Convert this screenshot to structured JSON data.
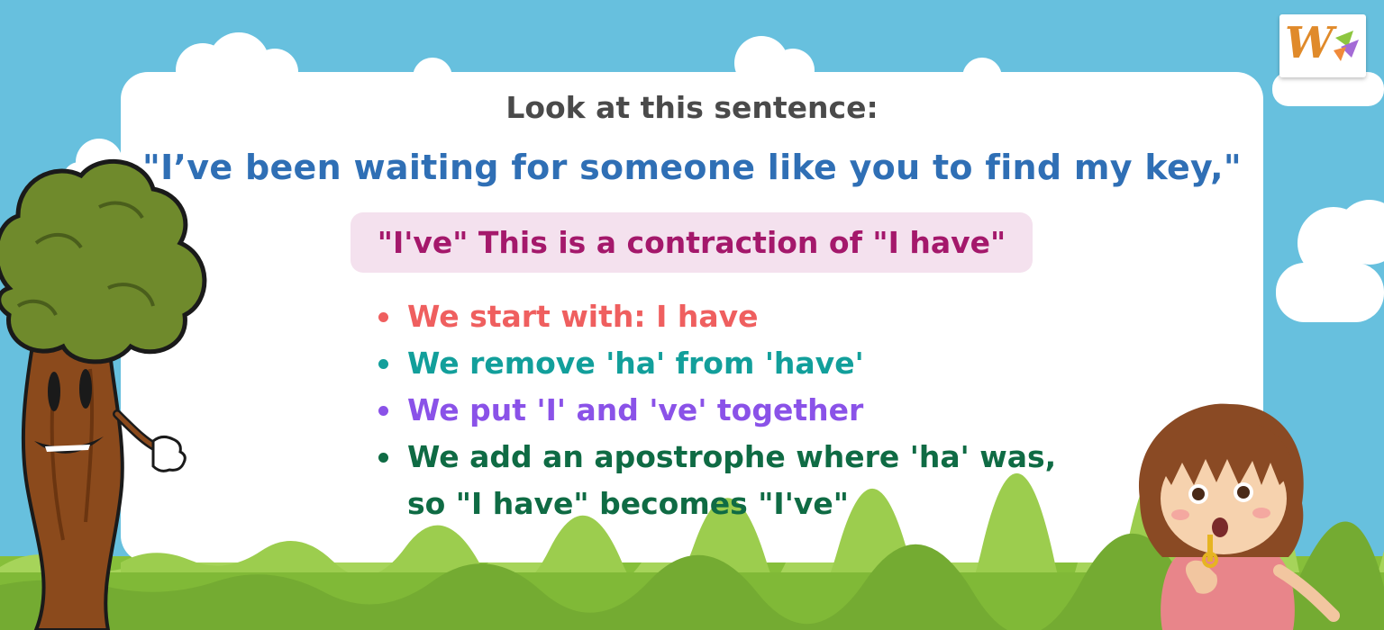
{
  "lesson": {
    "heading": "Look at this sentence:",
    "sentence": "\"I’ve been waiting for someone like you to find my key,\"",
    "explanation": "\"I've\" This is a contraction of \"I have\"",
    "steps": [
      {
        "text": "We start with: I have",
        "color": "#ef5f5f"
      },
      {
        "text": "We remove 'ha' from 'have'",
        "color": "#129f9b"
      },
      {
        "text": "We put 'I' and 've' together",
        "color": "#8a52e8"
      },
      {
        "text": "We add an apostrophe where 'ha' was,",
        "text2": "so \"I have\" becomes \"I've\"",
        "color": "#0f6b44"
      }
    ]
  },
  "brand": {
    "logo_letter": "W",
    "icon": "brand-logo-icon",
    "accent": "#e08a2a"
  },
  "colors": {
    "sky": "#67c0de",
    "card": "#ffffff",
    "grass": "#8cc63f",
    "pill": "#f4e1ee"
  },
  "characters": {
    "left": "tree-character-icon",
    "right": "girl-character-icon"
  }
}
